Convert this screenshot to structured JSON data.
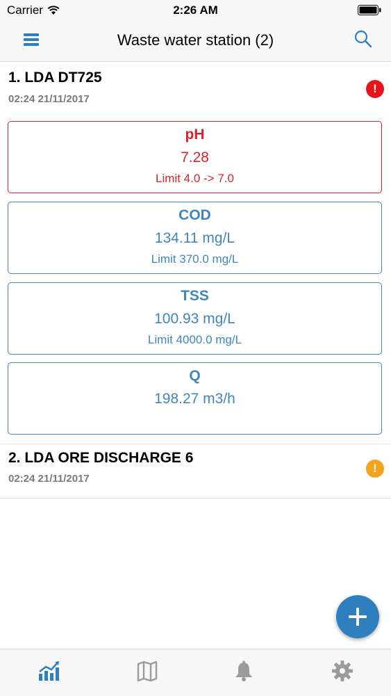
{
  "status_bar": {
    "carrier": "Carrier",
    "time": "2:26 AM"
  },
  "nav": {
    "title": "Waste water station (2)"
  },
  "stations": [
    {
      "name": "1. LDA DT725",
      "timestamp": "02:24 21/11/2017",
      "alert": "!",
      "alert_color": "#e8141c",
      "params": [
        {
          "name": "pH",
          "value": "7.28",
          "limit": "Limit 4.0 -> 7.0",
          "status": "alarm"
        },
        {
          "name": "COD",
          "value": "134.11 mg/L",
          "limit": "Limit 370.0 mg/L",
          "status": "normal"
        },
        {
          "name": "TSS",
          "value": "100.93 mg/L",
          "limit": "Limit 4000.0 mg/L",
          "status": "normal"
        },
        {
          "name": "Q",
          "value": "198.27 m3/h",
          "limit": "",
          "status": "normal"
        }
      ]
    },
    {
      "name": "2. LDA ORE DISCHARGE 6",
      "timestamp": "02:24 21/11/2017",
      "alert": "!",
      "alert_color": "#f5a21c"
    }
  ],
  "colors": {
    "accent": "#2f7fbf",
    "alarm": "#d9232b",
    "normal": "#3f86bf"
  },
  "tabs": [
    "chart-icon",
    "map-icon",
    "bell-icon",
    "gear-icon"
  ]
}
